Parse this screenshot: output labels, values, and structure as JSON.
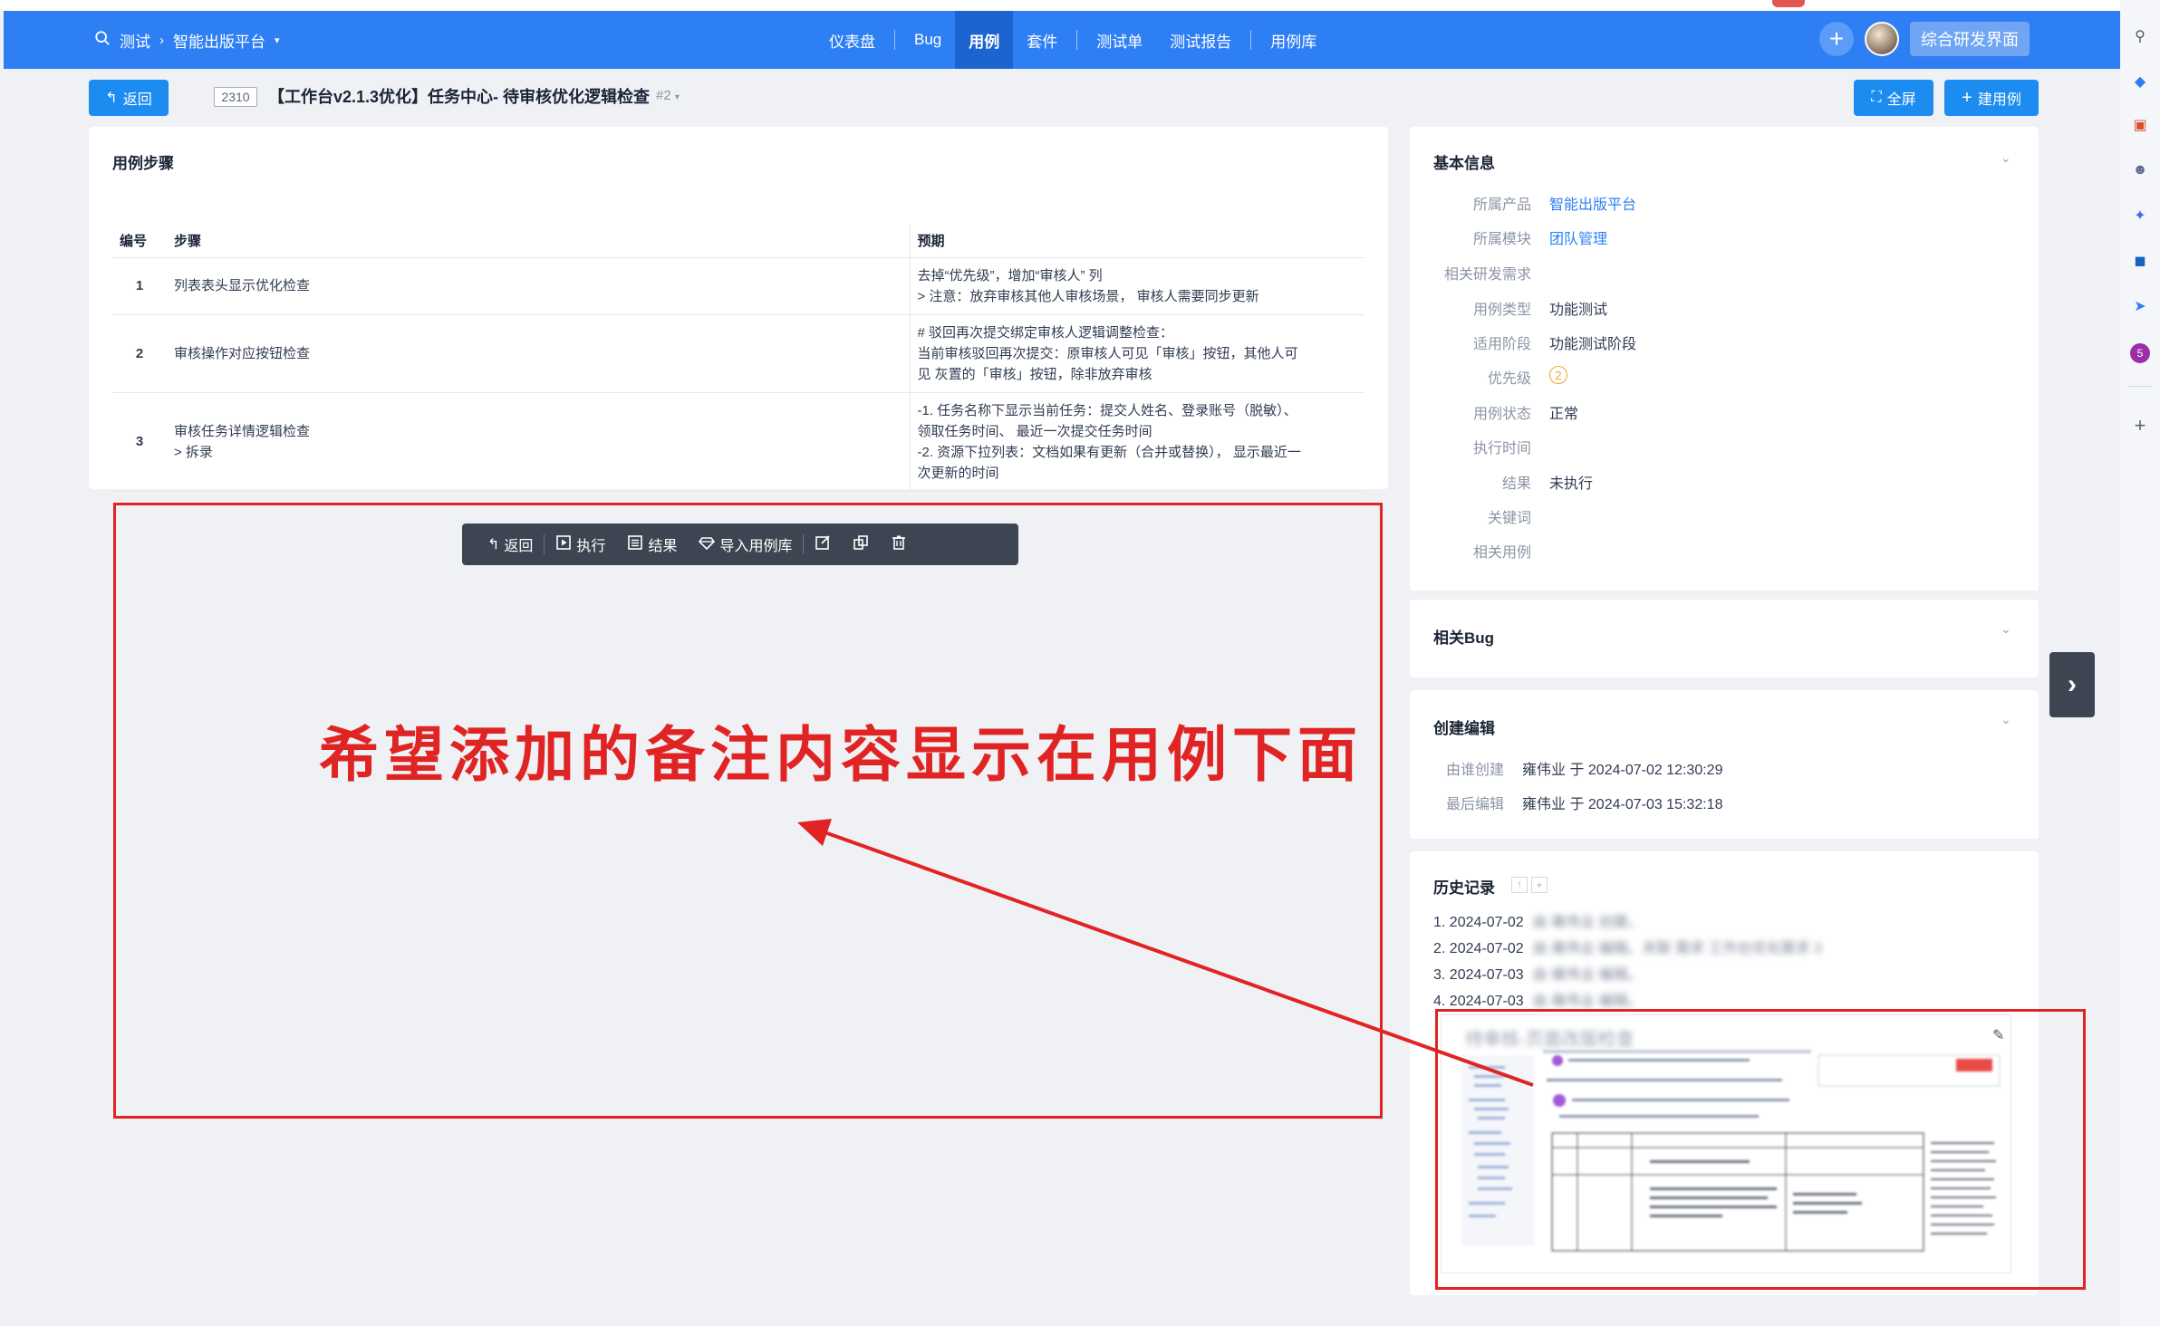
{
  "header": {
    "project": "测试",
    "product": "智能出版平台",
    "nav": [
      {
        "label": "仪表盘",
        "active": false
      },
      {
        "label": "Bug",
        "active": false
      },
      {
        "label": "用例",
        "active": true
      },
      {
        "label": "套件",
        "active": false
      },
      {
        "label": "测试单",
        "active": false
      },
      {
        "label": "测试报告",
        "active": false
      },
      {
        "label": "用例库",
        "active": false
      }
    ],
    "product_button": "综合研发界面"
  },
  "subbar": {
    "back": "返回",
    "case_id": "2310",
    "title": "【工作台v2.1.3优化】任务中心- 待审核优化逻辑检查",
    "version": "#2",
    "fullscreen": "全屏",
    "create_case": "建用例"
  },
  "steps": {
    "title": "用例步骤",
    "headers": [
      "编号",
      "步骤",
      "预期"
    ],
    "rows": [
      {
        "num": "1",
        "step": [
          "列表表头显示优化检查"
        ],
        "expect": [
          "去掉“优先级”，增加“审核人” 列",
          "> 注意：放弃审核其他人审核场景， 审核人需要同步更新"
        ]
      },
      {
        "num": "2",
        "step": [
          "审核操作对应按钮检查"
        ],
        "expect": [
          "# 驳回再次提交绑定审核人逻辑调整检查：",
          "当前审核驳回再次提交：原审核人可见「审核」按钮，其他人可",
          "见 灰置的「审核」按钮，除非放弃审核"
        ]
      },
      {
        "num": "3",
        "step": [
          "审核任务详情逻辑检查",
          "> 拆录"
        ],
        "expect": [
          "-1. 任务名称下显示当前任务：提交人姓名、登录账号（脱敏）、",
          "领取任务时间、 最近一次提交任务时间",
          "-2. 资源下拉列表：文档如果有更新（合并或替换）， 显示最近一",
          "次更新的时间"
        ]
      }
    ]
  },
  "toolbar": {
    "back": "返回",
    "run": "执行",
    "result": "结果",
    "import": "导入用例库"
  },
  "annotation": {
    "text": "希望添加的备注内容显示在用例下面",
    "color": "#e02424"
  },
  "basic_info": {
    "title": "基本信息",
    "rows": [
      {
        "label": "所属产品",
        "value": "智能出版平台",
        "link": true
      },
      {
        "label": "所属模块",
        "value": "团队管理",
        "link": true
      },
      {
        "label": "相关研发需求",
        "value": ""
      },
      {
        "label": "用例类型",
        "value": "功能测试"
      },
      {
        "label": "适用阶段",
        "value": "功能测试阶段"
      },
      {
        "label": "优先级",
        "value": "2",
        "priority": true
      },
      {
        "label": "用例状态",
        "value": "正常"
      },
      {
        "label": "执行时间",
        "value": ""
      },
      {
        "label": "结果",
        "value": "未执行"
      },
      {
        "label": "关键词",
        "value": ""
      },
      {
        "label": "相关用例",
        "value": ""
      }
    ]
  },
  "related_bug": {
    "title": "相关Bug"
  },
  "create_edit": {
    "title": "创建编辑",
    "rows": [
      {
        "label": "由谁创建",
        "value": "雍伟业 于 2024-07-02 12:30:29"
      },
      {
        "label": "最后编辑",
        "value": "雍伟业 于 2024-07-03 15:32:18"
      }
    ]
  },
  "history": {
    "title": "历史记录",
    "items": [
      {
        "date": "1. 2024-07-02",
        "text": "由 雍伟业 创建。"
      },
      {
        "date": "2. 2024-07-02",
        "text": "由 雍伟业 编辑。关联 需求 工作台优化需求 3"
      },
      {
        "date": "3. 2024-07-03",
        "text": "由 雍伟业 编辑。"
      },
      {
        "date": "4. 2024-07-03",
        "text": "由 雍伟业 编辑。"
      }
    ],
    "thumb_title": "待审核-页面改版检查"
  },
  "right_sidebar": {
    "badge": "5"
  }
}
